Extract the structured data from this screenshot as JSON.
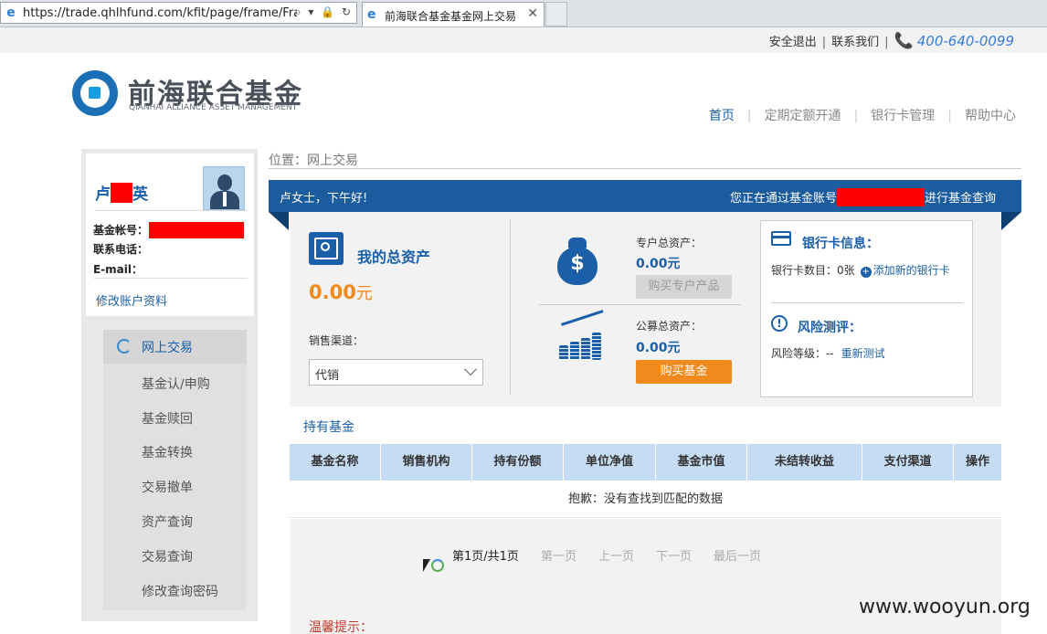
{
  "browser": {
    "url": "https://trade.qhlhfund.com/kfit/page/frame/Frame.",
    "tab_title": "前海联合基金基金网上交易",
    "ie_glyph": "e",
    "addr_controls": "⌕ ▾ 🔒 ↻",
    "tab_close": "✕"
  },
  "topbar": {
    "logout": "安全退出",
    "contact": "联系我们",
    "separator": "|",
    "phone_icon": "📞",
    "phone": "400-640-0099"
  },
  "logo": {
    "name": "前海联合基金",
    "en": "QIANHAI ALLIANCE ASSET MANAGEMENT"
  },
  "nav": {
    "items": [
      {
        "label": "首页"
      },
      {
        "label": "定期定额开通"
      },
      {
        "label": "银行卡管理"
      },
      {
        "label": "帮助中心"
      }
    ],
    "divider": "|"
  },
  "profile": {
    "name_first": "卢",
    "name_last": "英",
    "account_label": "基金帐号：",
    "phone_label": "联系电话：",
    "email_label": "E-mail：",
    "edit_link": "修改账户资料"
  },
  "sidebar": {
    "active": "网上交易",
    "items": [
      "基金认/申购",
      "基金赎回",
      "基金转换",
      "交易撤单",
      "资产查询",
      "交易查询",
      "修改查询密码"
    ]
  },
  "breadcrumb": "位置：网上交易",
  "band": {
    "greeting": "卢女士，下午好!",
    "account_prefix": "您正在通过基金账号",
    "account_suffix": "进行基金查询"
  },
  "assets": {
    "title": "我的总资产",
    "amount": "0.00",
    "unit": "元",
    "channel_label": "销售渠道：",
    "channel_value": "代销",
    "special_label": "专户总资产：",
    "special_amount": "0.00元",
    "special_button": "购买专户产品",
    "public_label": "公募总资产：",
    "public_amount": "0.00元",
    "public_button": "购买基金",
    "dollar_glyph": "$"
  },
  "bank": {
    "title": "银行卡信息：",
    "count_text": "银行卡数目：0张",
    "plus_glyph": "+",
    "add_card": "添加新的银行卡",
    "risk_glyph": "!",
    "risk_title": "风险测评：",
    "risk_level": "风险等级：--",
    "retest": "重新测试"
  },
  "holdings": {
    "title": "持有基金",
    "columns": [
      "基金名称",
      "销售机构",
      "持有份额",
      "单位净值",
      "基金市值",
      "未结转收益",
      "支付渠道",
      "操作"
    ],
    "empty_message": "抱歉：没有查找到匹配的数据",
    "pager": {
      "current": "第1页/共1页",
      "first": "第一页",
      "prev": "上一页",
      "next": "下一页",
      "last": "最后一页"
    }
  },
  "tip": "温馨提示：",
  "watermark": "www.wooyun.org",
  "colors": {
    "brand": "#1a5fa8",
    "accent": "#f08a1c",
    "redaction": "#ff0000"
  }
}
